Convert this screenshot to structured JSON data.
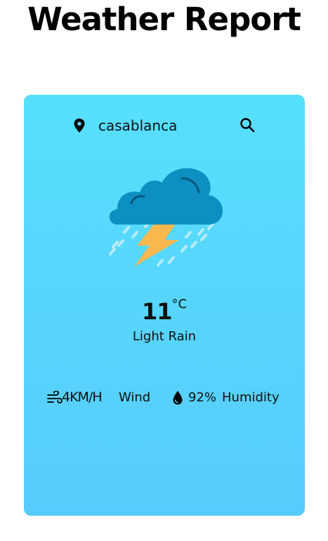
{
  "page": {
    "title": "Weather Report"
  },
  "search": {
    "city_value": "casablanca",
    "location_icon": "location-pin-icon",
    "search_icon": "search-icon"
  },
  "weather": {
    "icon": "thunderstorm-rain-icon",
    "temperature": "11",
    "unit": "°C",
    "condition": "Light Rain"
  },
  "details": {
    "wind_icon": "wind-icon",
    "wind_value": "4KM/H",
    "wind_label": "Wind",
    "humidity_icon": "water-drop-icon",
    "humidity_value": "92%",
    "humidity_label": "Humidity"
  },
  "colors": {
    "card_top": "#57e0fe",
    "card_bottom": "#57cbfb",
    "cloud": "#0d8fc1",
    "bolt": "#f8b84e",
    "rain": "#c9f0ff"
  }
}
